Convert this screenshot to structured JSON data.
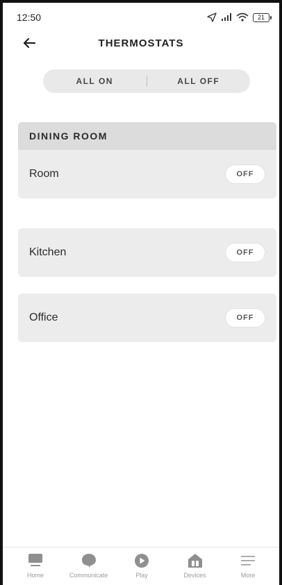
{
  "status": {
    "time": "12:50",
    "battery": "21"
  },
  "header": {
    "title": "THERMOSTATS"
  },
  "all_controls": {
    "on_label": "ALL ON",
    "off_label": "ALL OFF"
  },
  "groups": [
    {
      "header": "DINING ROOM",
      "rows": [
        {
          "label": "Room",
          "state": "OFF"
        }
      ]
    },
    {
      "rows": [
        {
          "label": "Kitchen",
          "state": "OFF"
        }
      ]
    },
    {
      "rows": [
        {
          "label": "Office",
          "state": "OFF"
        }
      ]
    }
  ],
  "bottom_nav": [
    {
      "label": "Home",
      "icon": "home-icon"
    },
    {
      "label": "Communicate",
      "icon": "chat-bubble-icon"
    },
    {
      "label": "Play",
      "icon": "play-icon"
    },
    {
      "label": "Devices",
      "icon": "devices-house-icon"
    },
    {
      "label": "More",
      "icon": "menu-icon"
    }
  ],
  "colors": {
    "card_bg": "#ececec",
    "header_bg": "#dcdcdc",
    "icon_gray": "#8f8f8f"
  }
}
